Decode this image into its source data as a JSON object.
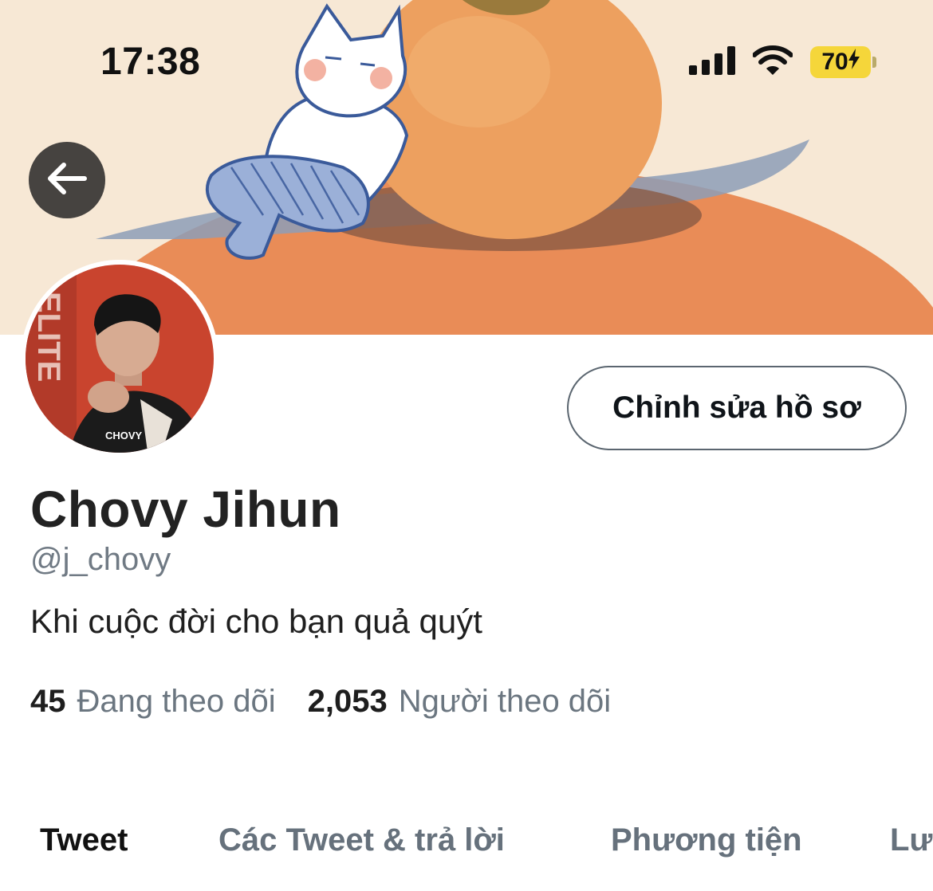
{
  "status_bar": {
    "time": "17:38",
    "battery": "70"
  },
  "profile": {
    "display_name": "Chovy Jihun",
    "handle": "@j_chovy",
    "bio": "Khi cuộc đời cho bạn quả quýt",
    "edit_button_label": "Chỉnh sửa hồ sơ",
    "avatar_text": "CHOVY"
  },
  "stats": {
    "following_count": "45",
    "following_label": "Đang theo dõi",
    "followers_count": "2,053",
    "followers_label": "Người theo dõi"
  },
  "tabs": [
    {
      "label": "Tweet",
      "active": true
    },
    {
      "label": "Các Tweet & trả lời",
      "active": false
    },
    {
      "label": "Phương tiện",
      "active": false
    },
    {
      "label": "Lượt thích",
      "active": false
    }
  ],
  "colors": {
    "banner_bg": "#f7e7d3",
    "tangerine": "#eaa060",
    "tangerine_dark": "#e98a55",
    "battery": "#f5d63a",
    "muted_text": "#6b7680"
  }
}
